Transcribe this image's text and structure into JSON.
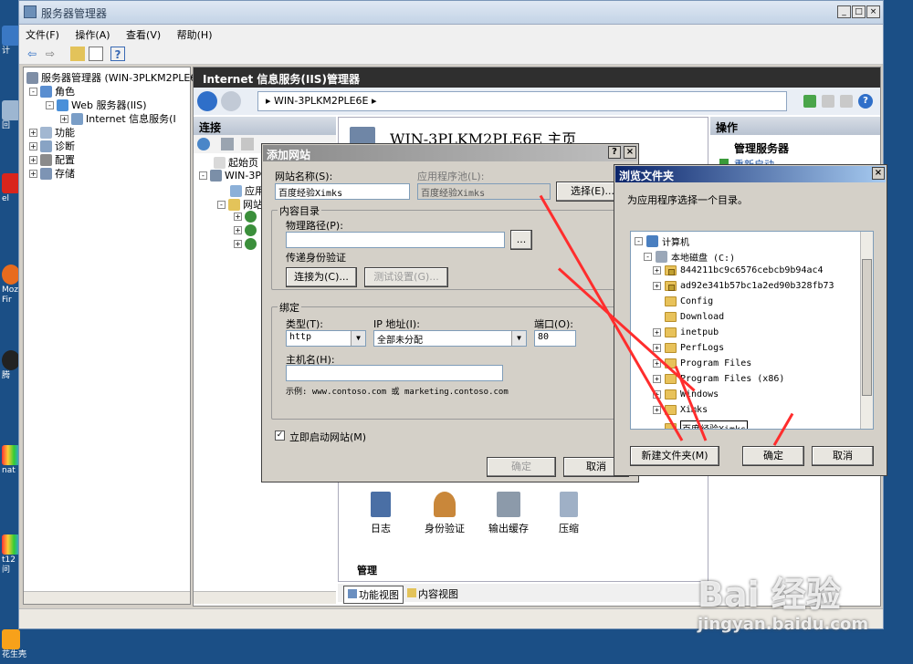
{
  "desktop": {
    "icons": [
      "计",
      "回",
      "el",
      "Moz Fir",
      "腾",
      "nat",
      "t12 问",
      "花生壳"
    ]
  },
  "window": {
    "title": "服务器管理器",
    "controls": [
      "_",
      "□",
      "×"
    ]
  },
  "menu": [
    "文件(F)",
    "操作(A)",
    "查看(V)",
    "帮助(H)"
  ],
  "left_tree": {
    "root": "服务器管理器 (WIN-3PLKM2PLE6E",
    "roles": "角色",
    "web_server": "Web 服务器(IIS)",
    "iis": "Internet 信息服务(I",
    "features": "功能",
    "diagnostics": "诊断",
    "config": "配置",
    "storage": "存储"
  },
  "iis": {
    "header": "Internet 信息服务(IIS)管理器",
    "address": "WIN-3PLKM2PLE6E",
    "connections_title": "连接",
    "conn_start": "起始页",
    "conn_server": "WIN-3P",
    "conn_apppool": "应用",
    "conn_sites": "网站",
    "home_title": "WIN-3PLKM2PLE6E 主页",
    "actions_title": "操作",
    "actions_manage": "管理服务器",
    "actions_restart": "重新启动",
    "features": [
      {
        "label": "日志",
        "icon": "log-icon"
      },
      {
        "label": "身份验证",
        "icon": "auth-icon"
      },
      {
        "label": "输出缓存",
        "icon": "output-cache-icon"
      },
      {
        "label": "压缩",
        "icon": "compression-icon"
      }
    ],
    "manage_group": "管理",
    "view_features": "功能视图",
    "view_content": "内容视图"
  },
  "add_site": {
    "title": "添加网站",
    "help": "?",
    "site_name_label": "网站名称(S):",
    "site_name_value": "百度经验Ximks",
    "app_pool_label": "应用程序池(L):",
    "app_pool_value": "百度经验Ximks",
    "select_btn": "选择(E)...",
    "content_group": "内容目录",
    "physical_path_label": "物理路径(P):",
    "physical_path_value": "",
    "browse_btn": "...",
    "passthrough_label": "传递身份验证",
    "connect_as_btn": "连接为(C)...",
    "test_settings_btn": "测试设置(G)...",
    "binding_group": "绑定",
    "type_label": "类型(T):",
    "type_value": "http",
    "ip_label": "IP 地址(I):",
    "ip_value": "全部未分配",
    "port_label": "端口(O):",
    "port_value": "80",
    "host_label": "主机名(H):",
    "host_value": "",
    "example_text": "示例: www.contoso.com 或 marketing.contoso.com",
    "start_checkbox": "立即启动网站(M)",
    "start_checked": true,
    "ok_btn": "确定",
    "cancel_btn": "取消"
  },
  "browse": {
    "title": "浏览文件夹",
    "instruction": "为应用程序选择一个目录。",
    "tree": {
      "computer": "计算机",
      "disk": "本地磁盘 (C:)",
      "folders": [
        {
          "name": "844211bc9c6576cebcb9b94ac4",
          "expand": true,
          "locked": true
        },
        {
          "name": "ad92e341b57bc1a2ed90b328fb73",
          "expand": true,
          "locked": true
        },
        {
          "name": "Config",
          "expand": false,
          "locked": false
        },
        {
          "name": "Download",
          "expand": false,
          "locked": false
        },
        {
          "name": "inetpub",
          "expand": true,
          "locked": false
        },
        {
          "name": "PerfLogs",
          "expand": true,
          "locked": false
        },
        {
          "name": "Program Files",
          "expand": true,
          "locked": false
        },
        {
          "name": "Program Files (x86)",
          "expand": true,
          "locked": false
        },
        {
          "name": "Windows",
          "expand": true,
          "locked": false
        },
        {
          "name": "Ximks",
          "expand": true,
          "locked": false
        }
      ],
      "new_folder_value": "百度经验Ximks"
    },
    "new_folder_btn": "新建文件夹(M)",
    "ok_btn": "确定",
    "cancel_btn": "取消"
  },
  "watermark": {
    "brand": "Bai 经验",
    "url": "jingyan.baidu.com"
  },
  "colors": {
    "desktop": "#1b4f86",
    "dialog_title_gradient_start": "#0a246a",
    "dialog_title_gradient_end": "#a6caf0",
    "annotation_arrow": "#ff2d2d"
  }
}
